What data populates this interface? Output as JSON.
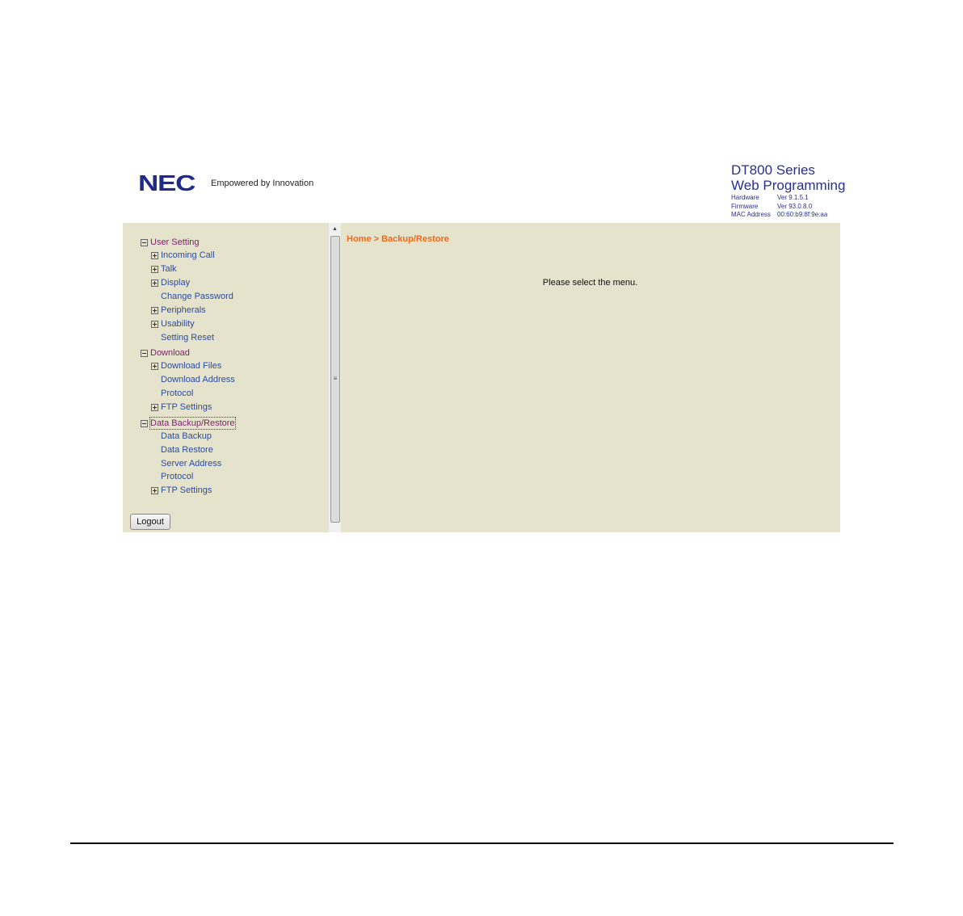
{
  "header": {
    "logo_text": "NEC",
    "tagline": "Empowered by Innovation",
    "product_line1": "DT800 Series",
    "product_line2": "Web Programming",
    "info": [
      {
        "label": "Hardware",
        "value": "Ver 9.1.5.1"
      },
      {
        "label": "Firmware",
        "value": "Ver 93.0.8.0"
      },
      {
        "label": "MAC Address",
        "value": "00:60:b9:8f:9e:aa"
      }
    ]
  },
  "sidebar": {
    "items": [
      {
        "label": "User Setting",
        "toggle": "minus",
        "level": 0
      },
      {
        "label": "Incoming Call",
        "toggle": "plus",
        "level": 1
      },
      {
        "label": "Talk",
        "toggle": "plus",
        "level": 1
      },
      {
        "label": "Display",
        "toggle": "plus",
        "level": 1
      },
      {
        "label": "Change Password",
        "toggle": "none",
        "level": 1
      },
      {
        "label": "Peripherals",
        "toggle": "plus",
        "level": 1
      },
      {
        "label": "Usability",
        "toggle": "plus",
        "level": 1
      },
      {
        "label": "Setting Reset",
        "toggle": "none",
        "level": 1
      },
      {
        "label": "Download",
        "toggle": "minus",
        "level": 0
      },
      {
        "label": "Download Files",
        "toggle": "plus",
        "level": 1
      },
      {
        "label": "Download Address",
        "toggle": "none",
        "level": 1
      },
      {
        "label": "Protocol",
        "toggle": "none",
        "level": 1
      },
      {
        "label": "FTP Settings",
        "toggle": "plus",
        "level": 1
      },
      {
        "label": "Data Backup/Restore",
        "toggle": "minus",
        "level": 0,
        "focused": true
      },
      {
        "label": "Data Backup",
        "toggle": "none",
        "level": 1
      },
      {
        "label": "Data Restore",
        "toggle": "none",
        "level": 1
      },
      {
        "label": "Server Address",
        "toggle": "none",
        "level": 1
      },
      {
        "label": "Protocol",
        "toggle": "none",
        "level": 1
      },
      {
        "label": "FTP Settings",
        "toggle": "plus",
        "level": 1
      }
    ],
    "logout_label": "Logout"
  },
  "main": {
    "breadcrumb": "Home > Backup/Restore",
    "message": "Please select the menu."
  },
  "colors": {
    "panel_bg": "#e6e3cd",
    "brand_blue": "#1f2a8a",
    "breadcrumb": "#ef6a1a",
    "tree_parent": "#7b1f6b",
    "tree_child": "#2c4c9c"
  }
}
